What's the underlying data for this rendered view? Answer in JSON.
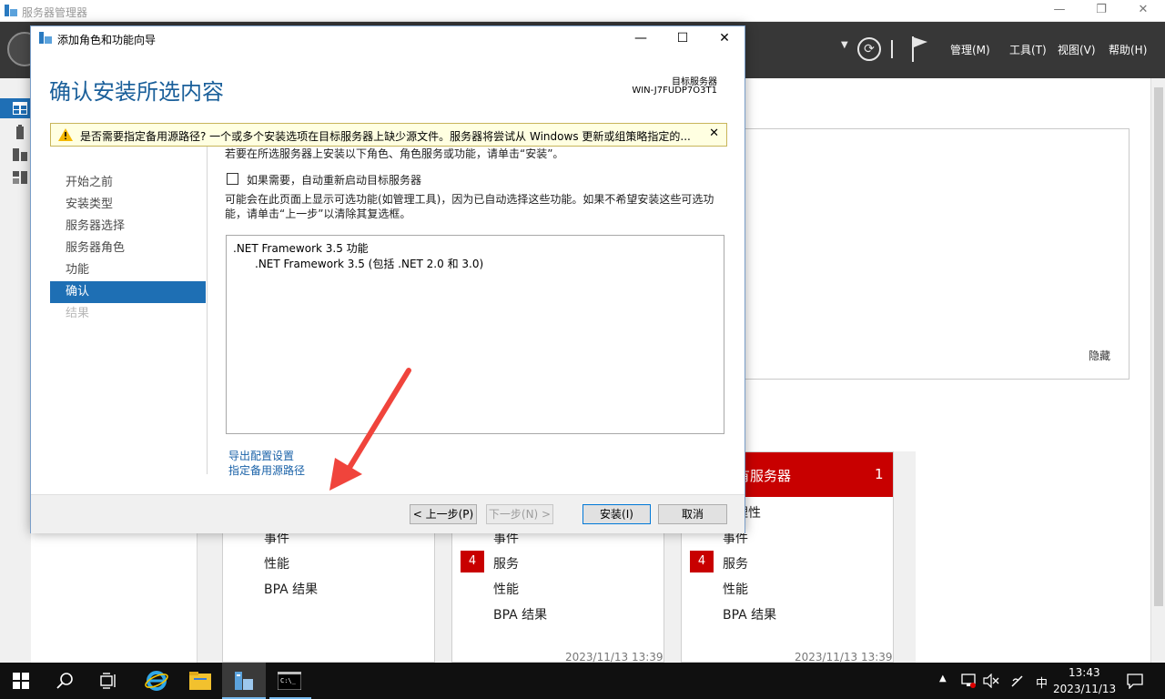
{
  "server_manager": {
    "title": "服务器管理器",
    "menu": [
      "管理(M)",
      "工具(T)",
      "视图(V)",
      "帮助(H)"
    ],
    "hide_link": "隐藏",
    "tiles": [
      {
        "rows": [
          "事件",
          "性能",
          "BPA 结果"
        ],
        "time": ""
      },
      {
        "rows": [
          "事件",
          "服务",
          "性能",
          "BPA 结果"
        ],
        "badge": "4",
        "time": "2023/11/13 13:39"
      },
      {
        "header": "有服务器",
        "header_count": "1",
        "rows": [
          "管理性",
          "事件",
          "服务",
          "性能",
          "BPA 结果"
        ],
        "badge": "4",
        "time": "2023/11/13 13:39"
      }
    ]
  },
  "wizard": {
    "title": "添加角色和功能向导",
    "heading": "确认安装所选内容",
    "target_label": "目标服务器",
    "target_name": "WIN-J7FUDP7O3T1",
    "warning": "是否需要指定备用源路径? 一个或多个安装选项在目标服务器上缺少源文件。服务器将尝试从 Windows 更新或组策略指定的...",
    "nav": [
      "开始之前",
      "安装类型",
      "服务器选择",
      "服务器角色",
      "功能",
      "确认",
      "结果"
    ],
    "intro": "若要在所选服务器上安装以下角色、角色服务或功能，请单击“安装”。",
    "restart_checkbox": "如果需要，自动重新启动目标服务器",
    "note": "可能会在此页面上显示可选功能(如管理工具)，因为已自动选择这些功能。如果不希望安装这些可选功能，请单击“上一步”以清除其复选框。",
    "features": [
      ".NET Framework 3.5 功能",
      ".NET Framework 3.5 (包括 .NET 2.0 和 3.0)"
    ],
    "export_link": "导出配置设置",
    "alt_source_link": "指定备用源路径",
    "buttons": {
      "prev": "< 上一步(P)",
      "next": "下一步(N) >",
      "install": "安装(I)",
      "cancel": "取消"
    }
  },
  "taskbar": {
    "ime": "中",
    "time": "13:43",
    "date": "2023/11/13"
  },
  "colors": {
    "accent": "#1e6fb4",
    "alert_red": "#c80000",
    "header_dark": "#373737",
    "annotation_arrow": "#f0443c"
  }
}
